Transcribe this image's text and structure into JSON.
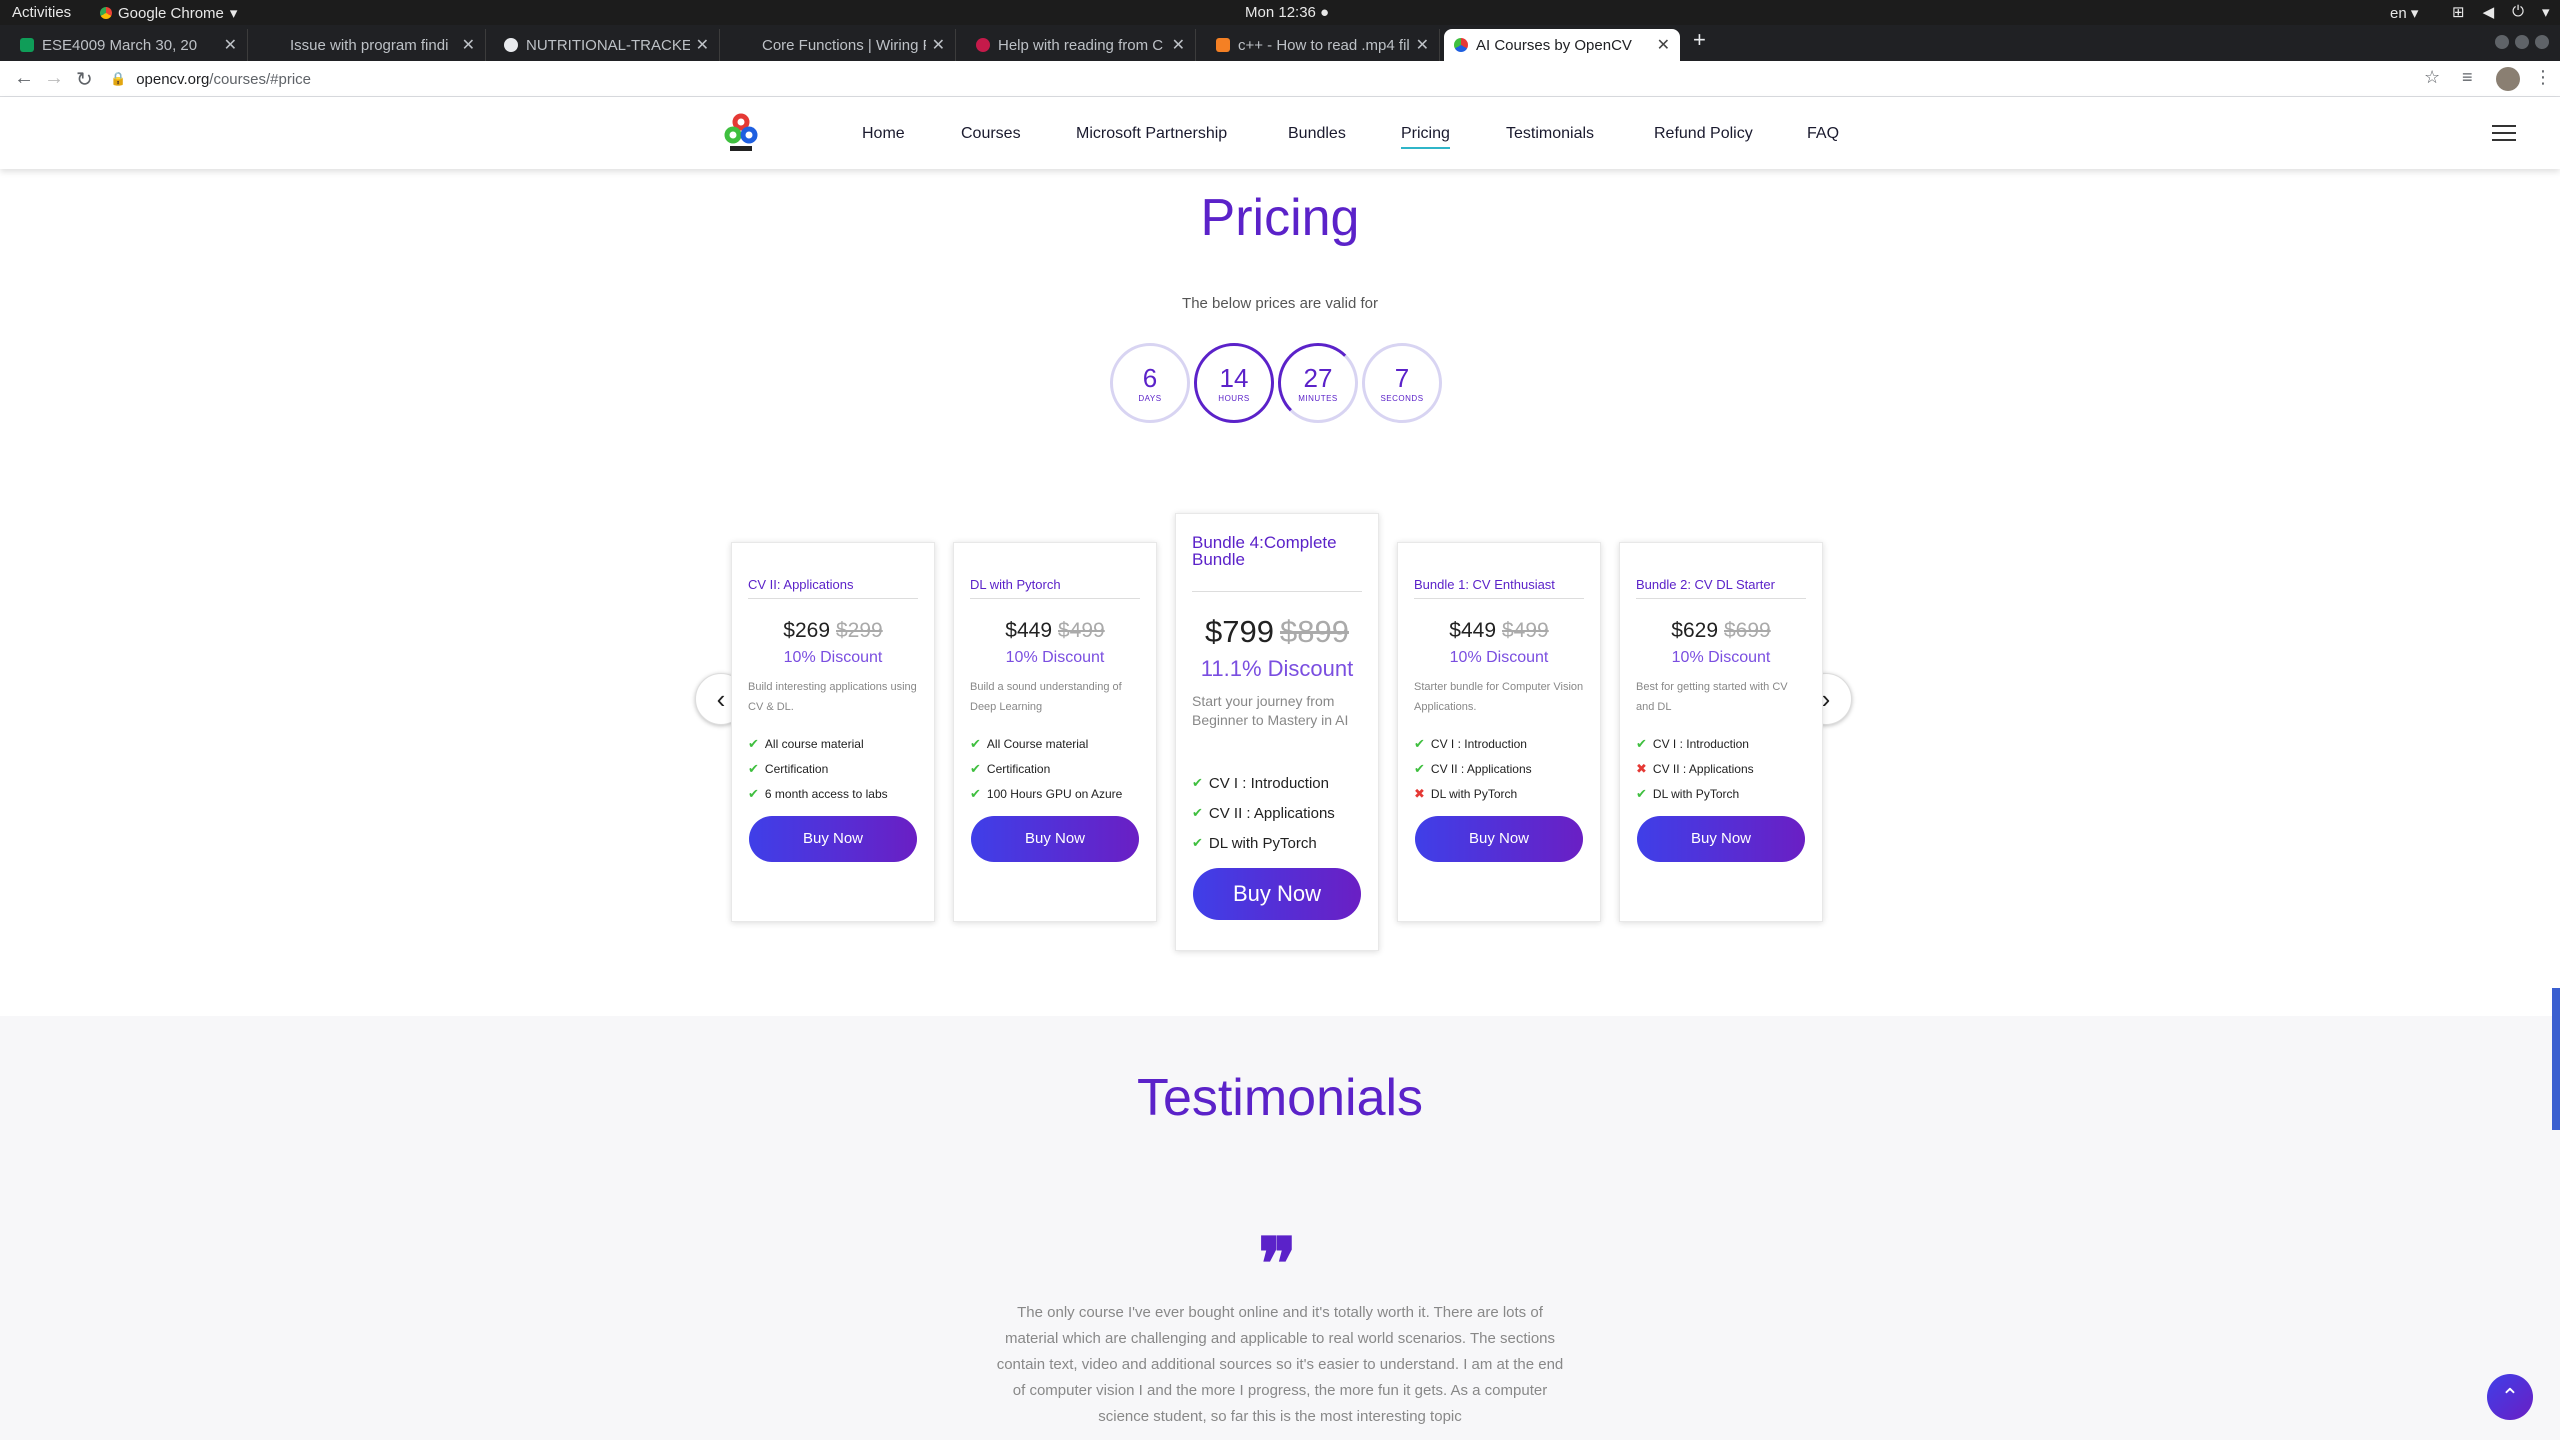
{
  "os": {
    "activities": "Activities",
    "app_name": "Google Chrome",
    "clock": "Mon 12:36 ●",
    "lang": "en ▾"
  },
  "browser": {
    "tabs": [
      {
        "title": "ESE4009 March 30, 20",
        "favicon_color": "#0f9d58",
        "active": false
      },
      {
        "title": "Issue with program findi",
        "favicon_color": "#202124",
        "active": false
      },
      {
        "title": "NUTRITIONAL-TRACKER/",
        "favicon_color": "#e8eaed",
        "active": false
      },
      {
        "title": "Core Functions | Wiring Pi",
        "favicon_color": "#202124",
        "active": false
      },
      {
        "title": "Help with reading from C",
        "favicon_color": "#c51a4a",
        "active": false
      },
      {
        "title": "c++ - How to read .mp4 fil",
        "favicon_color": "#f48024",
        "active": false
      },
      {
        "title": "AI Courses by OpenCV",
        "favicon_color": "#1f5fe0",
        "active": true
      }
    ],
    "url_host": "opencv.org",
    "url_path": "/courses/#price"
  },
  "site": {
    "nav": [
      "Home",
      "Courses",
      "Microsoft Partnership",
      "Bundles",
      "Pricing",
      "Testimonials",
      "Refund Policy",
      "FAQ"
    ],
    "active_nav": "Pricing"
  },
  "pricing": {
    "title": "Pricing",
    "valid_text": "The below prices are valid for",
    "countdown": [
      {
        "value": "6",
        "unit": "DAYS"
      },
      {
        "value": "14",
        "unit": "HOURS"
      },
      {
        "value": "27",
        "unit": "MINUTES"
      },
      {
        "value": "7",
        "unit": "SECONDS"
      }
    ],
    "cards": [
      {
        "title": "CV II: Applications",
        "price": "$269",
        "old_price": "$299",
        "discount": "10% Discount",
        "desc": "Build interesting applications using CV & DL.",
        "features": [
          {
            "text": "All course material",
            "included": true
          },
          {
            "text": "Certification",
            "included": true
          },
          {
            "text": "6 month access to labs",
            "included": true
          }
        ],
        "button": "Buy Now"
      },
      {
        "title": "DL with Pytorch",
        "price": "$449",
        "old_price": "$499",
        "discount": "10% Discount",
        "desc": "Build a sound understanding of Deep Learning",
        "features": [
          {
            "text": "All Course material",
            "included": true
          },
          {
            "text": "Certification",
            "included": true
          },
          {
            "text": "100 Hours GPU on Azure",
            "included": true
          }
        ],
        "button": "Buy Now"
      },
      {
        "title": "Bundle 4:Complete Bundle",
        "price": "$799",
        "old_price": "$899",
        "discount": "11.1% Discount",
        "desc": "Start your journey from Beginner to Mastery in AI",
        "features": [
          {
            "text": "CV I : Introduction",
            "included": true
          },
          {
            "text": "CV II : Applications",
            "included": true
          },
          {
            "text": "DL with PyTorch",
            "included": true
          }
        ],
        "button": "Buy Now"
      },
      {
        "title": "Bundle 1: CV Enthusiast",
        "price": "$449",
        "old_price": "$499",
        "discount": "10% Discount",
        "desc": "Starter bundle for Computer Vision Applications.",
        "features": [
          {
            "text": "CV I : Introduction",
            "included": true
          },
          {
            "text": "CV II : Applications",
            "included": true
          },
          {
            "text": "DL with PyTorch",
            "included": false
          }
        ],
        "button": "Buy Now"
      },
      {
        "title": "Bundle 2: CV DL Starter",
        "price": "$629",
        "old_price": "$699",
        "discount": "10% Discount",
        "desc": "Best for getting started with CV and DL",
        "features": [
          {
            "text": "CV I : Introduction",
            "included": true
          },
          {
            "text": "CV II : Applications",
            "included": false
          },
          {
            "text": "DL with PyTorch",
            "included": true
          }
        ],
        "button": "Buy Now"
      }
    ]
  },
  "testimonials": {
    "title": "Testimonials",
    "quote": "The only course I've ever bought online and it's totally worth it. There are lots of material which are challenging and applicable to real world scenarios. The sections contain text, video and additional sources so it's easier to understand. I am at the end of computer vision I and the more I progress, the more fun it gets. As a computer science student, so far this is the most interesting topic"
  },
  "colors": {
    "accent": "#5b22c9",
    "button_start": "#3f3fe8",
    "button_end": "#6a1fc4",
    "check": "#3fbf3f",
    "cross": "#e53935"
  }
}
